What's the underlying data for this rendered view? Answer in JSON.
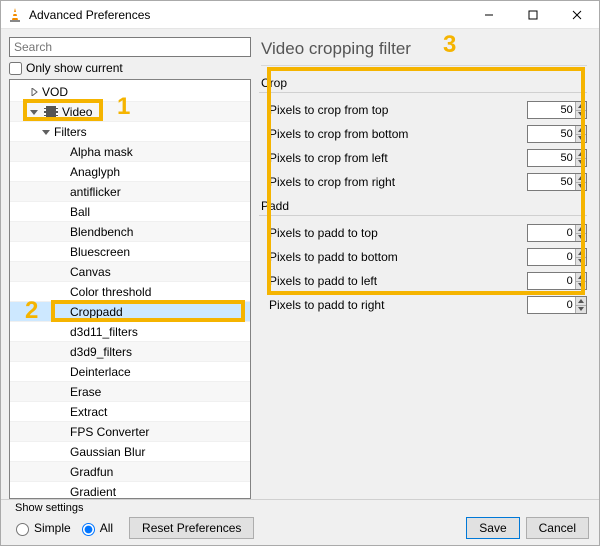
{
  "titlebar": {
    "title": "Advanced Preferences"
  },
  "search": {
    "placeholder": "Search"
  },
  "only_current": {
    "label": "Only show current"
  },
  "tree": {
    "vod": "VOD",
    "video": "Video",
    "filters_label": "Filters",
    "filters": [
      "Alpha mask",
      "Anaglyph",
      "antiflicker",
      "Ball",
      "Blendbench",
      "Bluescreen",
      "Canvas",
      "Color threshold",
      "Croppadd",
      "d3d11_filters",
      "d3d9_filters",
      "Deinterlace",
      "Erase",
      "Extract",
      "FPS Converter",
      "Gaussian Blur",
      "Gradfun",
      "Gradient"
    ],
    "selected": "Croppadd"
  },
  "page_title": "Video cropping filter",
  "crop": {
    "title": "Crop",
    "fields": [
      {
        "label": "Pixels to crop from top",
        "value": 50
      },
      {
        "label": "Pixels to crop from bottom",
        "value": 50
      },
      {
        "label": "Pixels to crop from left",
        "value": 50
      },
      {
        "label": "Pixels to crop from right",
        "value": 50
      }
    ]
  },
  "padd": {
    "title": "Padd",
    "fields": [
      {
        "label": "Pixels to padd to top",
        "value": 0
      },
      {
        "label": "Pixels to padd to bottom",
        "value": 0
      },
      {
        "label": "Pixels to padd to left",
        "value": 0
      },
      {
        "label": "Pixels to padd to right",
        "value": 0
      }
    ]
  },
  "footer": {
    "show_settings": "Show settings",
    "simple": "Simple",
    "all": "All",
    "reset": "Reset Preferences",
    "save": "Save",
    "cancel": "Cancel"
  },
  "markers": {
    "m1": "1",
    "m2": "2",
    "m3": "3"
  }
}
